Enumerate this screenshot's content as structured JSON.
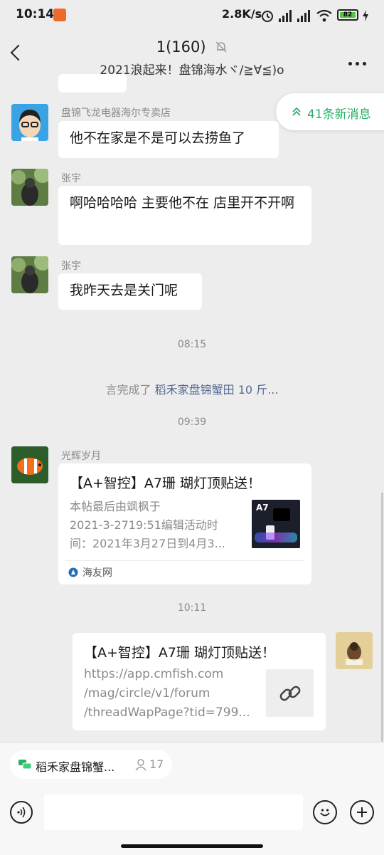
{
  "status_bar": {
    "time": "10:14",
    "net_speed": "2.8K/s",
    "battery": "82"
  },
  "nav": {
    "title": "1(160)",
    "subtitle": "2021浪起来！盘锦海水ヾ/≧∀≦)o"
  },
  "new_messages": "41条新消息",
  "messages": [
    {
      "sender": "盘锦飞龙电器海尔专卖店",
      "text": "他不在家是不是可以去捞鱼了"
    },
    {
      "sender": "张宇",
      "text": "啊哈哈哈哈 主要他不在 店里开不开啊"
    },
    {
      "sender": "张宇",
      "text": "我昨天去是关门呢"
    }
  ],
  "time_1": "08:15",
  "system_message": {
    "prefix": "言完成了",
    "link": "稻禾家盘锦蟹田 10 斤..."
  },
  "time_2": "09:39",
  "card_message": {
    "sender": "光辉岁月",
    "title": "【A+智控】A7珊 瑚灯顶贴送！",
    "desc": "本帖最后由飒枫于2021-3-2719:51编辑活动时间：2021年3月27日到4月3...",
    "desc_line1": "本帖最后由飒枫于",
    "desc_line2": "2021-3-2719:51编辑活动时",
    "desc_line3": "间：2021年3月27日到4月3...",
    "source": "海友网",
    "thumb_label": "A7"
  },
  "time_3": "10:11",
  "my_link_message": {
    "title": "【A+智控】A7珊 瑚灯顶贴送！",
    "url_line1": "https://app.cmfish.com",
    "url_line2": "/mag/circle/v1/forum",
    "url_line3": "/threadWapPage?tid=799..."
  },
  "bottom": {
    "group_name": "稻禾家盘锦蟹...",
    "group_count": "17"
  },
  "colors": {
    "accent_green": "#2bae67",
    "link_blue": "#576b95"
  }
}
